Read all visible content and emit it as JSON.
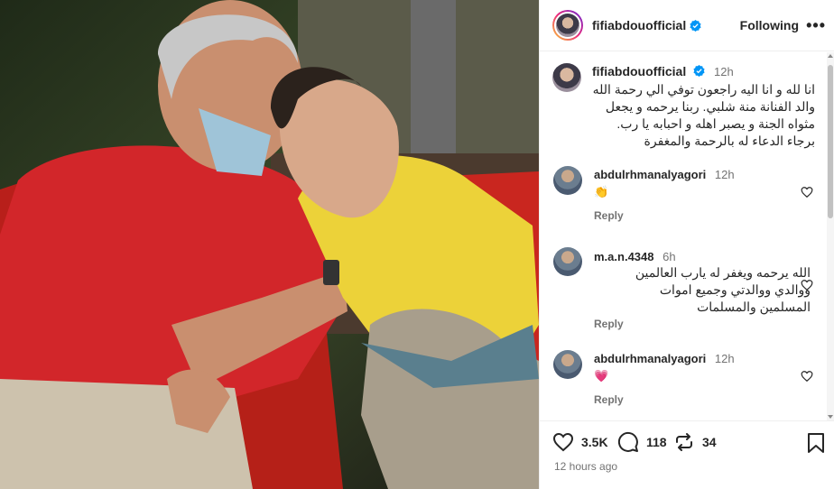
{
  "post": {
    "username": "fifiabdouofficial",
    "follow_label": "Following",
    "more_label": "•••",
    "verified_icon": "verified-badge-icon"
  },
  "caption": {
    "username": "fifiabdouofficial",
    "time": "12h",
    "text": "انا لله و انا اليه راجعون توفي الي رحمة الله\nوالد الفنانة منة شلبي. ربنا يرحمه و يجعل\nمثواه الجنة و يصبر اهله و احبابه يا رب.\nبرجاء الدعاء له بالرحمة والمغفرة"
  },
  "comments": [
    {
      "username": "abdulrhmanalyagori",
      "time": "12h",
      "text": "👏",
      "reply_label": "Reply"
    },
    {
      "username": "m.a.n.4348",
      "time": "6h",
      "text": "الله يرحمه ويغفر له يارب العالمين\nووالدي ووالدتي وجميع اموات\nالمسلمين والمسلمات",
      "reply_label": "Reply"
    },
    {
      "username": "abdulrhmanalyagori",
      "time": "12h",
      "text": "💗",
      "reply_label": "Reply"
    }
  ],
  "actions": {
    "likes": "3.5K",
    "comments": "118",
    "reposts": "34",
    "posted_time": "12 hours ago"
  },
  "colors": {
    "accent_blue": "#0095f6",
    "muted_text": "#737373",
    "border": "#efefef"
  }
}
